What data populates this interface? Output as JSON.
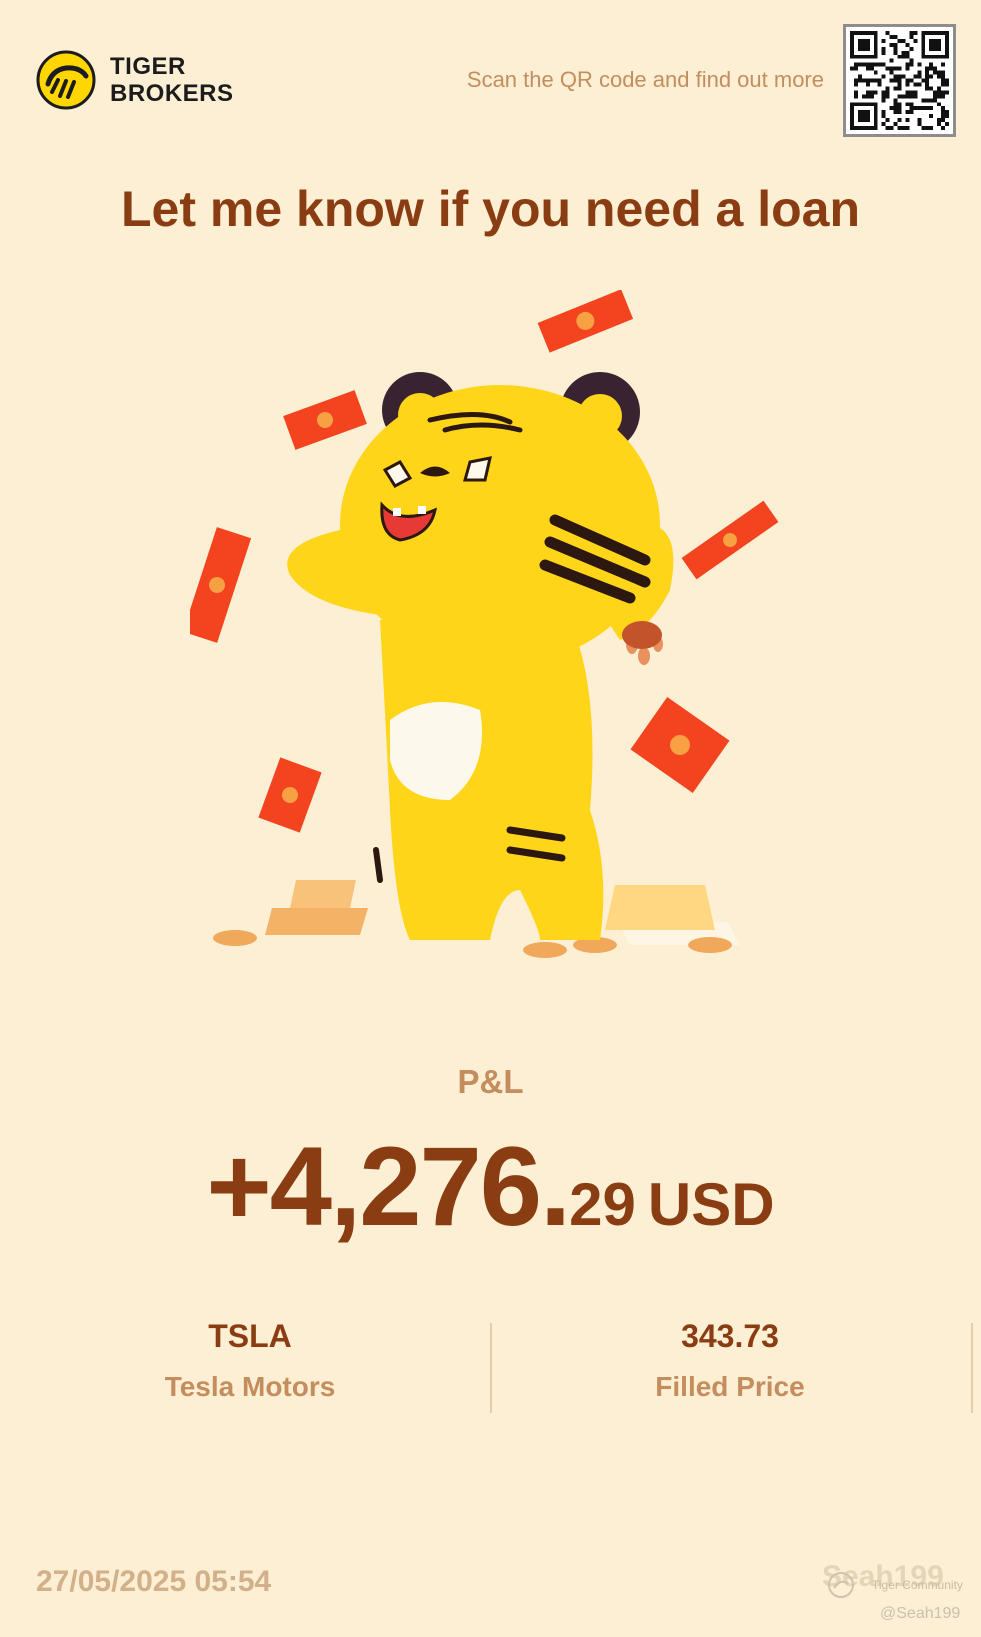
{
  "header": {
    "brand_line1": "TIGER",
    "brand_line2": "BROKERS",
    "scan_text": "Scan the QR code and find out more"
  },
  "headline": "Let me know if you need a loan",
  "pnl": {
    "label": "P&L",
    "value_main": "+4,276.",
    "value_decimal": "29",
    "currency": "USD"
  },
  "stats": [
    {
      "value": "TSLA",
      "label": "Tesla Motors"
    },
    {
      "value": "343.73",
      "label": "Filled Price"
    }
  ],
  "footer": {
    "timestamp": "27/05/2025 05:54",
    "watermark_name": "Seah199",
    "watermark_community": "Tiger Community",
    "watermark_handle": "@Seah199"
  },
  "colors": {
    "background": "#fcefd3",
    "headline": "#8a3d12",
    "muted": "#c48d5e",
    "tiger_yellow": "#ffd81a",
    "envelope_red": "#f4431f"
  },
  "icons": {
    "logo": "tiger-logo-icon",
    "qr": "qr-code-icon"
  }
}
